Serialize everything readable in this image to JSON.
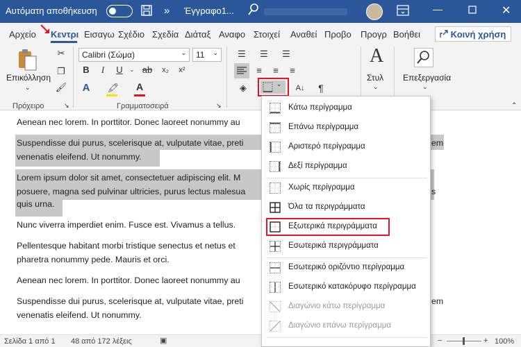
{
  "titlebar": {
    "autosave_label": "Αυτόματη αποθήκευση",
    "doc_title": "Έγγραφο1..."
  },
  "tabs": [
    "Αρχείο",
    "Κεντρι",
    "Εισαγω",
    "Σχέδιο",
    "Σχεδία",
    "Διάταξ",
    "Αναφο",
    "Στοιχεί",
    "Αναθεί",
    "Προβο",
    "Προγρ",
    "Βοήθει"
  ],
  "share_label": "Κοινή χρήση",
  "ribbon": {
    "paste_label": "Επικόλληση",
    "font_name": "Calibri (Σώμα)",
    "font_size": "11",
    "style_label": "Στυλ",
    "editing_label": "Επεξεργασία",
    "group_clipboard": "Πρόχειρο",
    "group_font": "Γραμματοσειρά"
  },
  "paragraphs": [
    "Aenean nec lorem. In porttitor. Donec laoreet nonummy au",
    "Suspendisse dui purus, scelerisque at, vulputate vitae, preti",
    "venenatis eleifend. Ut nonummy.",
    "Lorem ipsum dolor sit amet, consectetuer adipiscing elit. M",
    "posuere, magna sed pulvinar ultricies, purus lectus malesua",
    "quis urna.",
    "Nunc viverra imperdiet enim. Fusce est. Vivamus a tellus.",
    "Pellentesque habitant morbi tristique senectus et netus et",
    "pharetra nonummy pede. Mauris et orci.",
    "Aenean nec lorem. In porttitor. Donec laoreet nonummy au",
    "Suspendisse dui purus, scelerisque at, vulputate vitae, preti",
    "venenatis eleifend. Ut nonummy."
  ],
  "right_edge_words": [
    "em",
    "s",
    "em"
  ],
  "menu_items": [
    {
      "label": "Κάτω περίγραμμα",
      "disabled": false
    },
    {
      "label": "Επάνω περίγραμμα",
      "disabled": false
    },
    {
      "label": "Αριστερό περίγραμμα",
      "disabled": false
    },
    {
      "label": "Δεξί περίγραμμα",
      "disabled": false
    },
    {
      "label": "Χωρίς περίγραμμα",
      "disabled": false
    },
    {
      "label": "Όλα τα περιγράμματα",
      "disabled": false
    },
    {
      "label": "Εξωτερικά περιγράμματα",
      "disabled": false
    },
    {
      "label": "Εσωτερικά περιγράμματα",
      "disabled": false
    },
    {
      "label": "Εσωτερικό οριζόντιο περίγραμμα",
      "disabled": false
    },
    {
      "label": "Εσωτερικό κατακόρυφο περίγραμμα",
      "disabled": false
    },
    {
      "label": "Διαγώνιο κάτω περίγραμμα",
      "disabled": true
    },
    {
      "label": "Διαγώνιο επάνω περίγραμμα",
      "disabled": true
    }
  ],
  "status": {
    "page": "Σελίδα 1 από 1",
    "words": "48 από 172 λέξεις",
    "zoom": "100%"
  },
  "colors": {
    "brand": "#2b579a",
    "highlight_red": "#e81123"
  }
}
